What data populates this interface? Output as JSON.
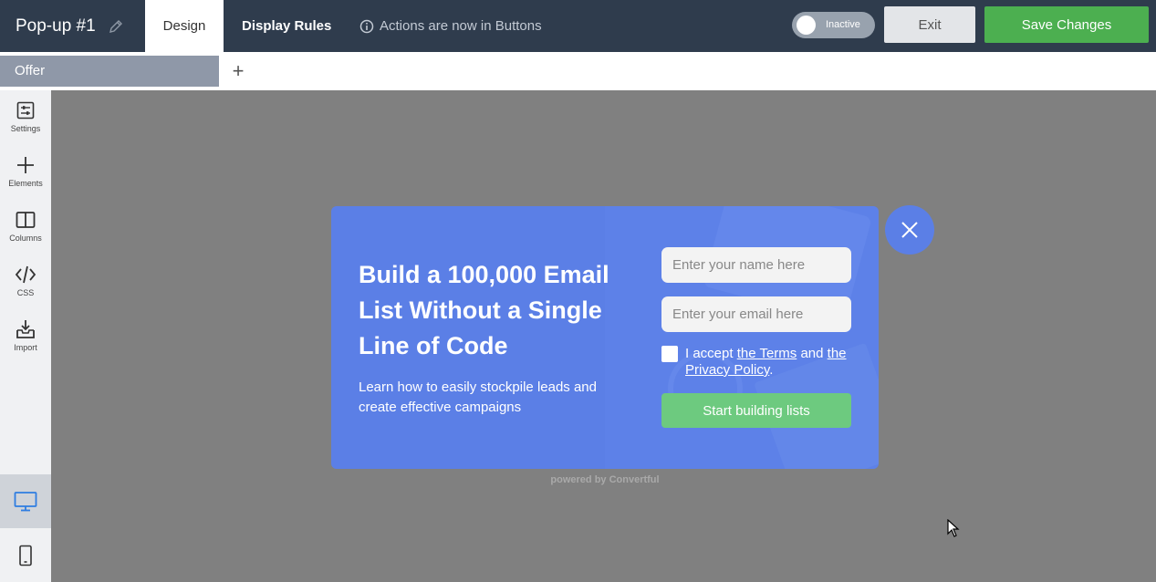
{
  "header": {
    "title": "Pop-up #1",
    "tabs": {
      "design": "Design",
      "display_rules": "Display Rules"
    },
    "notice": "Actions are now in Buttons",
    "toggle_label": "Inactive",
    "exit_label": "Exit",
    "save_label": "Save Changes"
  },
  "subbar": {
    "offer_tab": "Offer",
    "add_tab": "+"
  },
  "sidebar": {
    "items": [
      {
        "label": "Settings",
        "icon": "settings-icon"
      },
      {
        "label": "Elements",
        "icon": "plus-icon"
      },
      {
        "label": "Columns",
        "icon": "columns-icon"
      },
      {
        "label": "CSS",
        "icon": "code-icon"
      },
      {
        "label": "Import",
        "icon": "import-icon"
      }
    ],
    "devices": [
      "desktop-icon",
      "mobile-icon"
    ]
  },
  "popup": {
    "headline": "Build a 100,000 Email List Without a Single Line of Code",
    "subtext": "Learn how to easily stockpile leads and create effective campaigns",
    "name_placeholder": "Enter your name here",
    "email_placeholder": "Enter your email here",
    "terms_prefix": "I accept ",
    "terms_link": "the Terms",
    "terms_mid": " and ",
    "privacy_link": "the Privacy Policy",
    "terms_suffix": ".",
    "cta_label": "Start building lists",
    "powered_by": "powered by Convertful"
  },
  "colors": {
    "topbar": "#2f3c4d",
    "popup_bg": "#5b7fe6",
    "save_green": "#4caf50",
    "cta_green": "#6dca7f",
    "canvas_gray": "#808080"
  }
}
